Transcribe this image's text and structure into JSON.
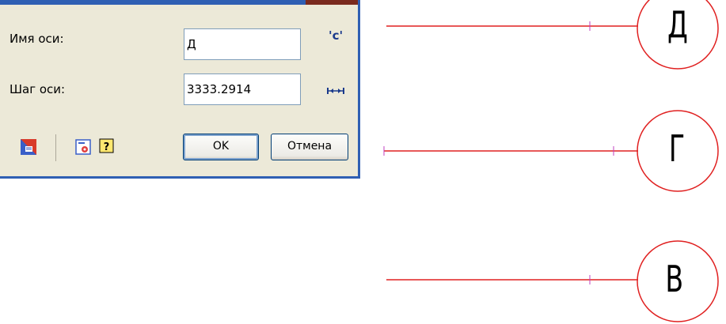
{
  "dialog": {
    "axis_name_label": "Имя оси:",
    "axis_name_value": "Д",
    "insert_text_glyph": "'c'",
    "axis_step_label": "Шаг оси:",
    "axis_step_value": "3333.2914",
    "ok_label": "OK",
    "cancel_label": "Отмена"
  },
  "drawing": {
    "axis_bubbles": [
      "Д",
      "Г",
      "В"
    ],
    "line_color": "#e02020",
    "marker_color": "#c040c0"
  },
  "colors": {
    "dialog_bg": "#ece9d8",
    "title_blue": "#2f5fb3"
  }
}
